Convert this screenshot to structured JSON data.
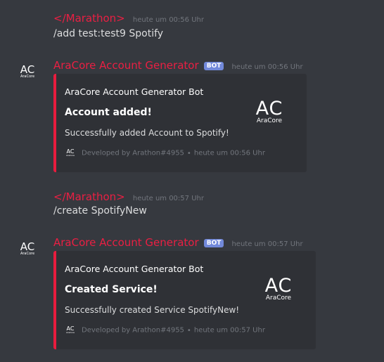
{
  "messages": [
    {
      "author": "</Marathon>",
      "timestamp": "heute um 00:56 Uhr",
      "content": "/add test:test9 Spotify"
    },
    {
      "author": "AraCore Account Generator",
      "bot_badge": "BOT",
      "timestamp": "heute um 00:56 Uhr",
      "avatar": {
        "logo": "AC",
        "sub": "AraCore"
      },
      "embed": {
        "author": "AraCore Account Generator Bot",
        "title": "Account added!",
        "description": "Successfully added Account to Spotify!",
        "footer_text": "Developed by Arathon#4955",
        "footer_separator": "•",
        "footer_time": "heute um 00:56 Uhr",
        "footer_icon": {
          "logo": "AC",
          "sub": "AraCore"
        },
        "thumbnail": {
          "logo": "AC",
          "sub": "AraCore"
        },
        "accent_color": "#e81c3e"
      }
    },
    {
      "author": "</Marathon>",
      "timestamp": "heute um 00:57 Uhr",
      "content": "/create SpotifyNew"
    },
    {
      "author": "AraCore Account Generator",
      "bot_badge": "BOT",
      "timestamp": "heute um 00:57 Uhr",
      "avatar": {
        "logo": "AC",
        "sub": "AraCore"
      },
      "embed": {
        "author": "AraCore Account Generator Bot",
        "title": "Created Service!",
        "description": "Successfully created Service SpotifyNew!",
        "footer_text": "Developed by Arathon#4955",
        "footer_separator": "•",
        "footer_time": "heute um 00:57 Uhr",
        "footer_icon": {
          "logo": "AC",
          "sub": "AraCore"
        },
        "thumbnail": {
          "logo": "AC",
          "sub": "AraCore"
        },
        "accent_color": "#e81c3e"
      }
    }
  ],
  "colors": {
    "background": "#36393f",
    "embed_background": "#2f3136",
    "username_red": "#ea1f43",
    "bot_badge": "#7289da",
    "timestamp": "#72767d"
  }
}
